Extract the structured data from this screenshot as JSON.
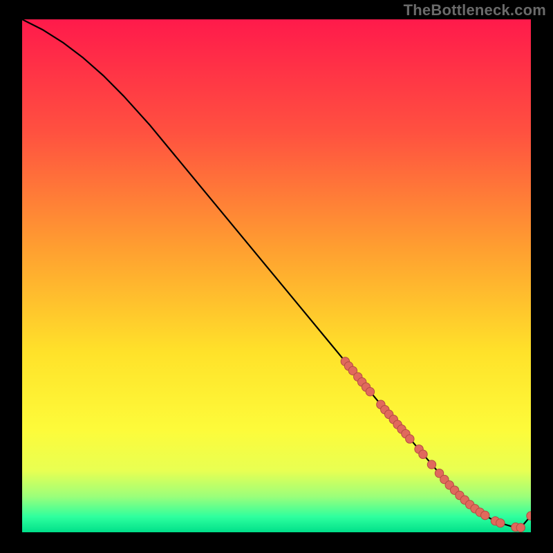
{
  "watermark": "TheBottleneck.com",
  "colors": {
    "bg": "#000000",
    "curve": "#000000",
    "dot_fill": "#e0695c",
    "dot_stroke": "#b34c42",
    "watermark": "#6a6a6a",
    "grad_stops": [
      {
        "pct": 0,
        "c": "#ff1a4b"
      },
      {
        "pct": 22,
        "c": "#ff5140"
      },
      {
        "pct": 45,
        "c": "#ffa030"
      },
      {
        "pct": 65,
        "c": "#ffe22a"
      },
      {
        "pct": 80,
        "c": "#fdfb3a"
      },
      {
        "pct": 88,
        "c": "#e8ff52"
      },
      {
        "pct": 93,
        "c": "#9cff7a"
      },
      {
        "pct": 97,
        "c": "#2eff9e"
      },
      {
        "pct": 100,
        "c": "#00e08a"
      }
    ]
  },
  "chart_data": {
    "type": "line",
    "title": "",
    "xlabel": "",
    "ylabel": "",
    "xlim": [
      0,
      100
    ],
    "ylim": [
      0,
      100
    ],
    "series": [
      {
        "name": "bottleneck-curve",
        "x": [
          0,
          4,
          8,
          12,
          16,
          20,
          25,
          30,
          35,
          40,
          45,
          50,
          55,
          60,
          65,
          70,
          73,
          76,
          79,
          82,
          84,
          86,
          88,
          90,
          92,
          94,
          96,
          98,
          100
        ],
        "y": [
          100,
          98,
          95.5,
          92.5,
          89,
          85,
          79.5,
          73.5,
          67.5,
          61.5,
          55.5,
          49.5,
          43.5,
          37.5,
          31.5,
          25.5,
          22,
          18.5,
          15,
          11.5,
          9.2,
          7.2,
          5.4,
          3.9,
          2.7,
          1.8,
          1.2,
          0.9,
          3.2
        ]
      }
    ],
    "points": {
      "name": "highlighted-samples",
      "x": [
        63.5,
        64.2,
        65.0,
        66.0,
        66.8,
        67.6,
        68.4,
        70.5,
        71.3,
        72.1,
        73.0,
        73.8,
        74.6,
        75.4,
        76.2,
        78.0,
        78.8,
        80.5,
        82.0,
        83.0,
        84.0,
        85.0,
        86.0,
        87.0,
        88.0,
        89.0,
        90.0,
        91.0,
        93.0,
        94.0,
        97.0,
        98.0,
        100.0
      ],
      "y": [
        33.3,
        32.4,
        31.5,
        30.3,
        29.3,
        28.3,
        27.4,
        24.9,
        23.9,
        23.0,
        22.0,
        21.0,
        20.1,
        19.2,
        18.2,
        16.2,
        15.2,
        13.2,
        11.5,
        10.3,
        9.2,
        8.2,
        7.2,
        6.3,
        5.4,
        4.6,
        3.9,
        3.3,
        2.2,
        1.8,
        1.0,
        0.9,
        3.2
      ]
    }
  }
}
